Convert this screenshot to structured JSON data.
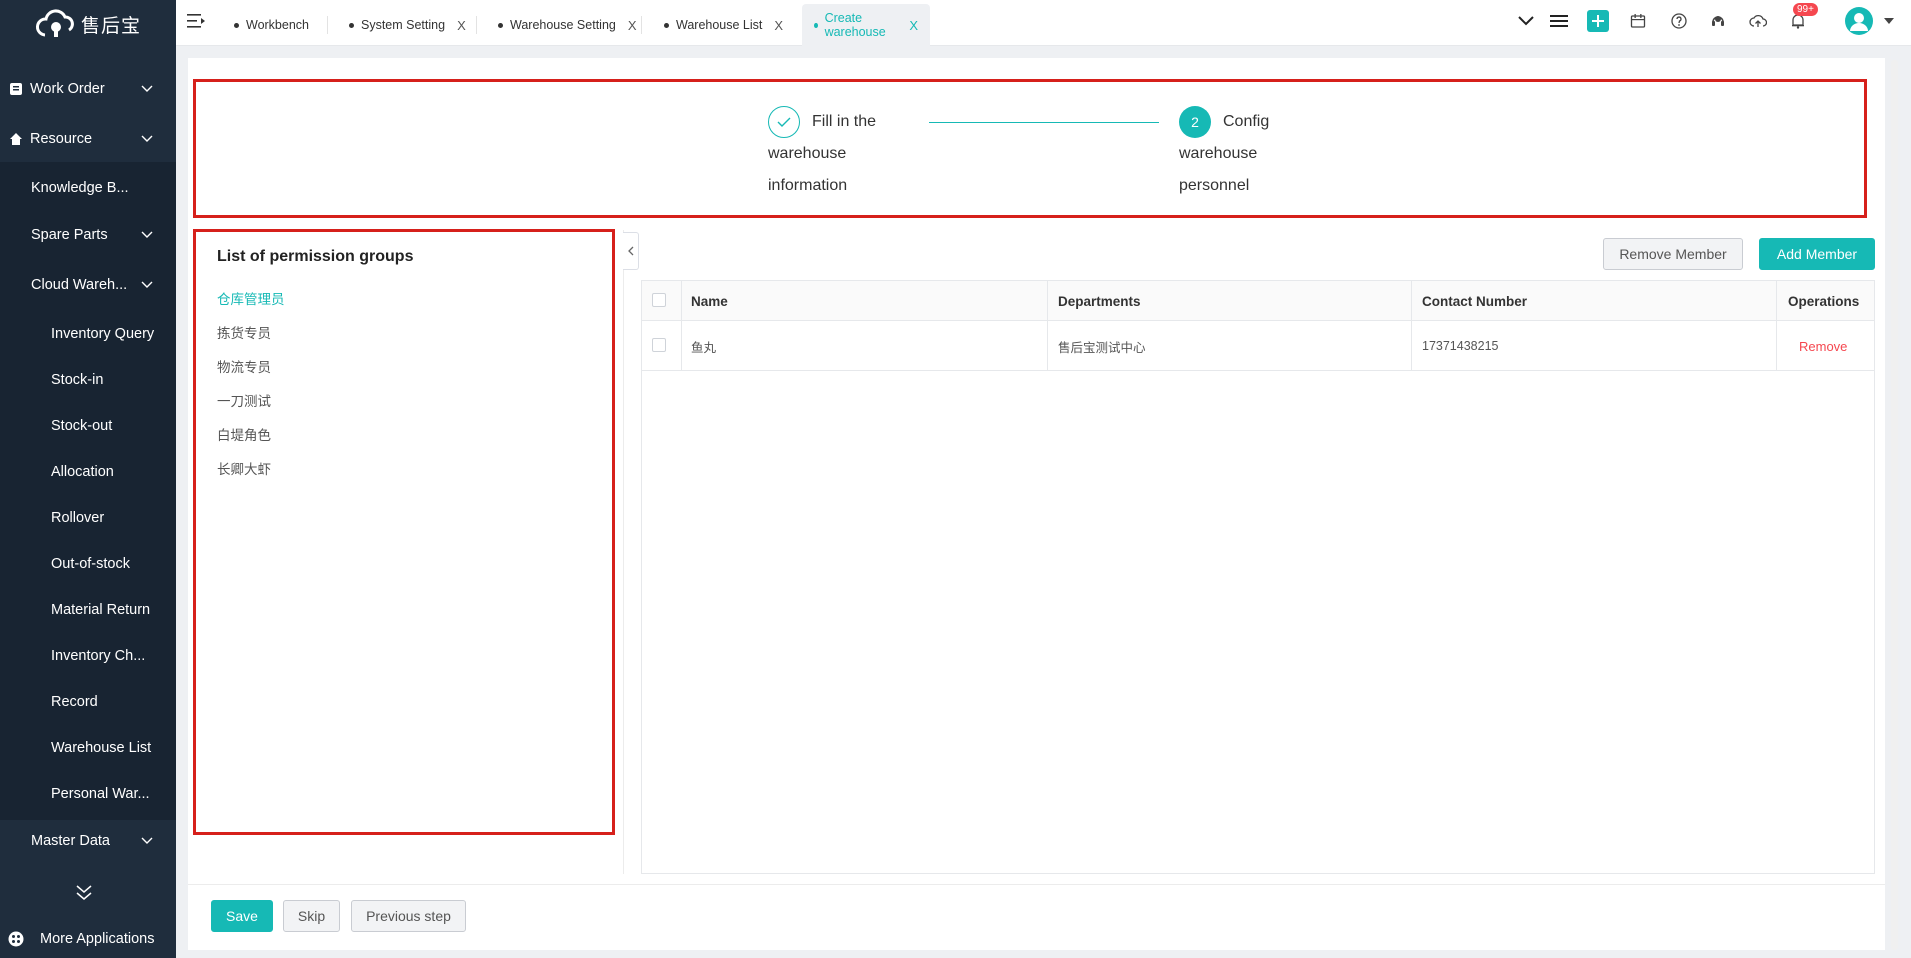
{
  "brand": {
    "logo_text": "售后宝"
  },
  "sidebar": {
    "items": [
      {
        "label": "Work Order"
      },
      {
        "label": "Resource"
      },
      {
        "label": "Knowledge B..."
      },
      {
        "label": "Spare Parts"
      },
      {
        "label": "Cloud Wareh..."
      },
      {
        "label": "Inventory Query"
      },
      {
        "label": "Stock-in"
      },
      {
        "label": "Stock-out"
      },
      {
        "label": "Allocation"
      },
      {
        "label": "Rollover"
      },
      {
        "label": "Out-of-stock"
      },
      {
        "label": "Material Return"
      },
      {
        "label": "Inventory Ch..."
      },
      {
        "label": "Record"
      },
      {
        "label": "Warehouse List"
      },
      {
        "label": "Personal War..."
      },
      {
        "label": "Master Data"
      }
    ],
    "more_apps": "More Applications"
  },
  "tabs": [
    {
      "label": "Workbench"
    },
    {
      "label": "System Setting"
    },
    {
      "label": "Warehouse Setting"
    },
    {
      "label": "Warehouse List"
    },
    {
      "label": "Create warehouse"
    }
  ],
  "tab_close": "X",
  "header": {
    "notification_badge": "99+"
  },
  "steps": {
    "step1": {
      "line1": "Fill in the",
      "line2": "warehouse",
      "line3": "information"
    },
    "step2": {
      "number": "2",
      "line1": "Config",
      "line2": "warehouse",
      "line3": "personnel"
    }
  },
  "groups": {
    "title": "List of permission groups",
    "items": [
      "仓库管理员",
      "拣货专员",
      "物流专员",
      "一刀测试",
      "白堤角色",
      "长卿大虾"
    ],
    "selected": "仓库管理员"
  },
  "actions": {
    "remove_member": "Remove Member",
    "add_member": "Add Member"
  },
  "table": {
    "columns": [
      "Name",
      "Departments",
      "Contact Number",
      "Operations"
    ],
    "rows": [
      {
        "name": "鱼丸",
        "department": "售后宝测试中心",
        "contact": "17371438215",
        "operation": "Remove"
      }
    ]
  },
  "footer": {
    "save": "Save",
    "skip": "Skip",
    "previous": "Previous step"
  },
  "colors": {
    "accent": "#16b9b5",
    "sidebar_bg": "#1f2d3d",
    "danger": "#f5474f",
    "highlight_box": "#d6201b"
  }
}
